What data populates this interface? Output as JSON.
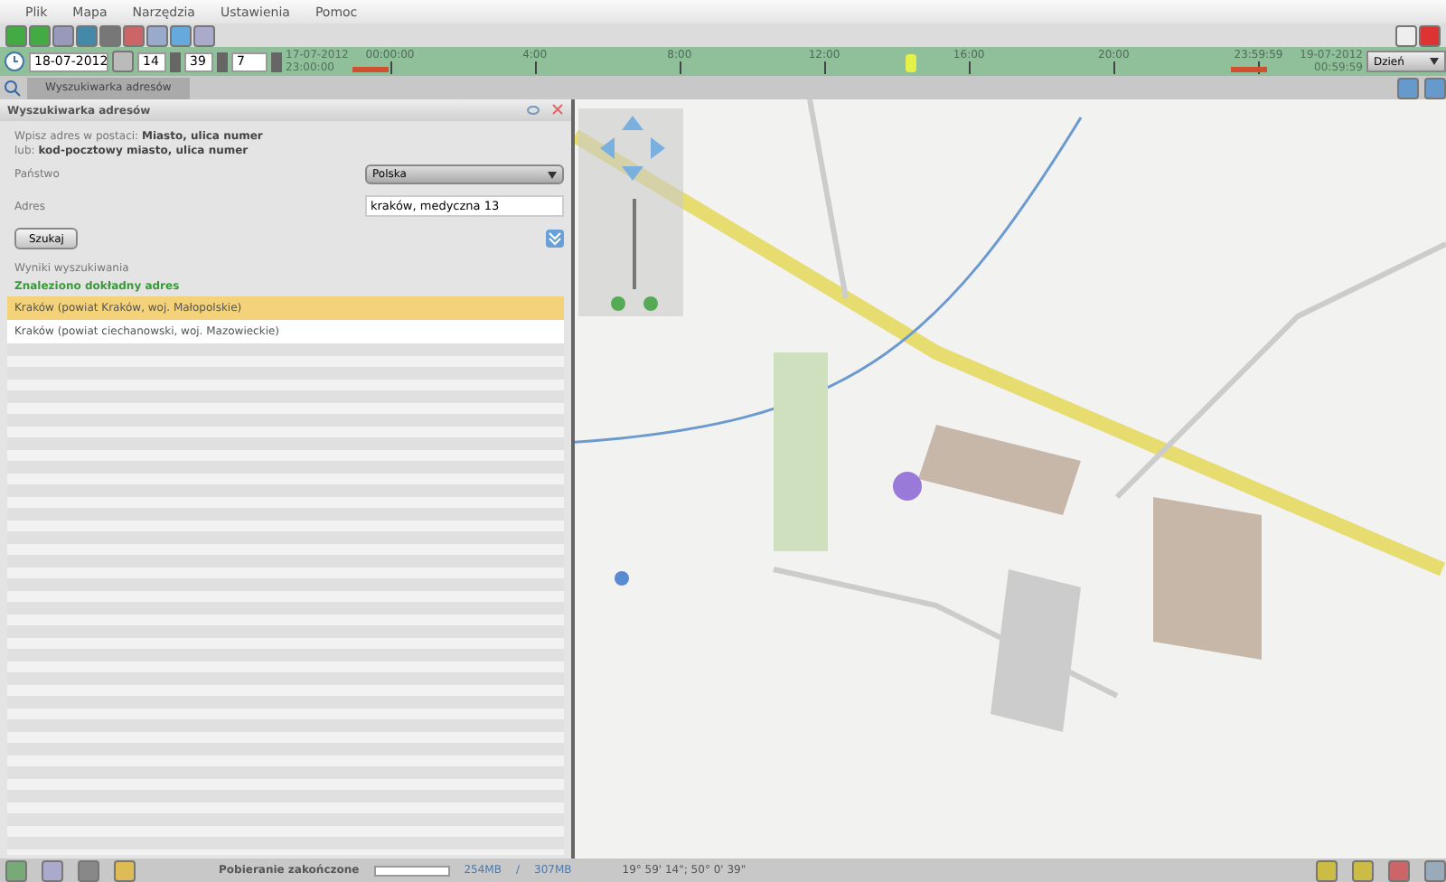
{
  "menu": [
    "Plik",
    "Mapa",
    "Narzędzia",
    "Ustawienia",
    "Pomoc"
  ],
  "timeline": {
    "date": "18-07-2012",
    "hour": "14",
    "minute": "39",
    "span": "7",
    "start_date": "17-07-2012",
    "start_time": "23:00:00",
    "end_date": "19-07-2012",
    "end_time": "00:59:59",
    "ticks": [
      "00:00:00",
      "4:00",
      "8:00",
      "12:00",
      "16:00",
      "20:00",
      "23:59:59"
    ],
    "level": 0.6,
    "range": "Dzień"
  },
  "tabs": [
    {
      "label": "Wyszukiwarka adresów",
      "selected": true
    }
  ],
  "panel": {
    "title": "Wyszukiwarka adresów",
    "hint_1": "Wpisz adres w postaci: **Miasto, ulica numer**",
    "hint_2": "lub: **kod-pocztowy miasto, ulica numer**",
    "country_label": "Państwo",
    "country": "Polska",
    "address_label": "Adres",
    "address": "kraków, medyczna 13",
    "search_button": "Szukaj",
    "results_label": "Wyniki wyszukiwania",
    "found": "Znaleziono dokładny adres",
    "results": [
      {
        "label": "Kraków (powiat Kraków, woj. Małopolskie)",
        "selected": true
      },
      {
        "label": "Kraków (powiat ciechanowski, woj. Mazowieckie)",
        "selected": false
      }
    ]
  },
  "status_bar": {
    "message": "Pobieranie zakończone",
    "progress": {
      "level": 0
    },
    "used": "254MB",
    "separator": "/",
    "total": "307MB",
    "coords": "19° 59' 14\"; 50° 0' 39\""
  }
}
